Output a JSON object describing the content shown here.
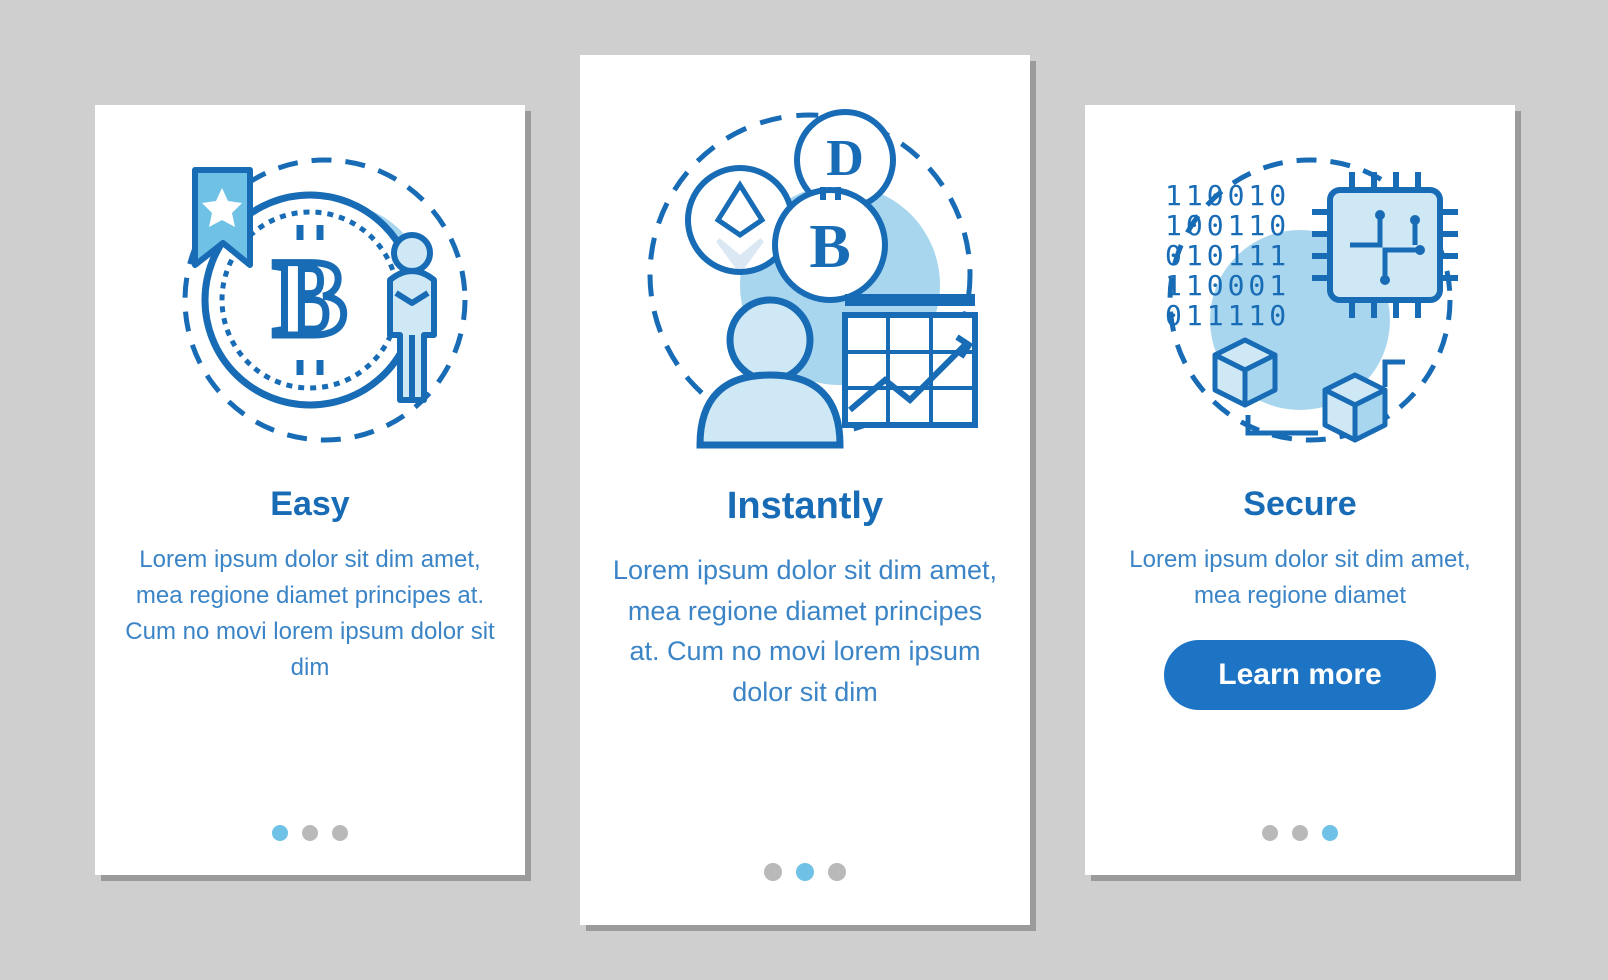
{
  "colors": {
    "accent": "#1d74c4",
    "light": "#a8d6ef",
    "mid": "#6fc2e6",
    "text": "#3b84c6",
    "grey": "#b9b9b9"
  },
  "cards": [
    {
      "icon": "bitcoin-bookmark-icon",
      "title": "Easy",
      "body": "Lorem ipsum dolor sit dim amet, mea regione diamet principes at. Cum no movi lorem ipsum dolor sit dim",
      "active_dot": 0,
      "button": null
    },
    {
      "icon": "crypto-chart-icon",
      "title": "Instantly",
      "body": "Lorem ipsum dolor sit dim amet, mea regione diamet principes at. Cum no movi lorem ipsum dolor sit dim",
      "active_dot": 1,
      "button": null
    },
    {
      "icon": "chip-security-icon",
      "title": "Secure",
      "body": "Lorem ipsum dolor sit dim amet, mea regione diamet",
      "active_dot": 2,
      "button": "Learn more"
    }
  ]
}
